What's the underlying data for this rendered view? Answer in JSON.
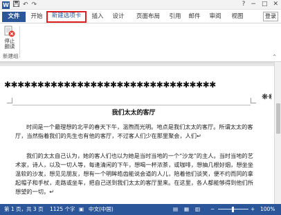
{
  "quick_access": {
    "app_icon": "W",
    "save_icon": "save-icon",
    "undo_icon": "undo-icon",
    "redo_icon": "redo-icon"
  },
  "tabs": [
    {
      "label": "文件"
    },
    {
      "label": "开始"
    },
    {
      "label": "新建选项卡"
    },
    {
      "label": "插入"
    },
    {
      "label": "设计"
    },
    {
      "label": "页面布局"
    },
    {
      "label": "引用"
    },
    {
      "label": "邮件"
    },
    {
      "label": "审阅"
    },
    {
      "label": "视图"
    }
  ],
  "login_label": "登录",
  "ribbon": {
    "button_label": "停止\n朗读",
    "group_label": "新建组"
  },
  "document": {
    "title": "我们太太的客厅",
    "para1": "时间是一个最理想的北平的春天下午，温煦而光明。地点是我们太太的客厅。所谓太太的客厅，当然指着我们的先生也有他的客厅，不过客人们少在那里聚会，人们↵",
    "para2": "我们的太太自己认为，她的客人们也以为她是当时当地的一个“沙龙”的主人。当时当地的艺术家，诗人，以及一切人等，每逢清闲的下午，想喝一杯浓茶，或咖啡，想抽几根好烟，想坐坐温软的沙发，想见见朋友，想有一个明眸皓齿能说会道的人儿，陪着他们谈笑，便不约而同的拿起帽子和手杖，走路或坐车，把自己送到我们太太的客厅里来。在这里，各人都能够得到他们所想望的一切。↵",
    "border_glyphs": "✱✱✱✱✱✱✱✱✱✱✱✱✱✱✱✱✱✱✱✱✱✱✱✱✱✱✱✱✱✱✱✱",
    "border_right": "❋❋❋❋❋❋❋❋❋❋❋❋"
  },
  "status": {
    "page": "第 1 页，共 3 页",
    "words": "1125 个字",
    "lang": "中文(中国)",
    "zoom": "100%",
    "zoom_minus": "−",
    "zoom_plus": "+"
  },
  "window_controls": {
    "help": "?",
    "min": "−",
    "max": "□",
    "close": "✕"
  },
  "colors": {
    "accent": "#2b579a",
    "highlight_border": "#e02020"
  }
}
